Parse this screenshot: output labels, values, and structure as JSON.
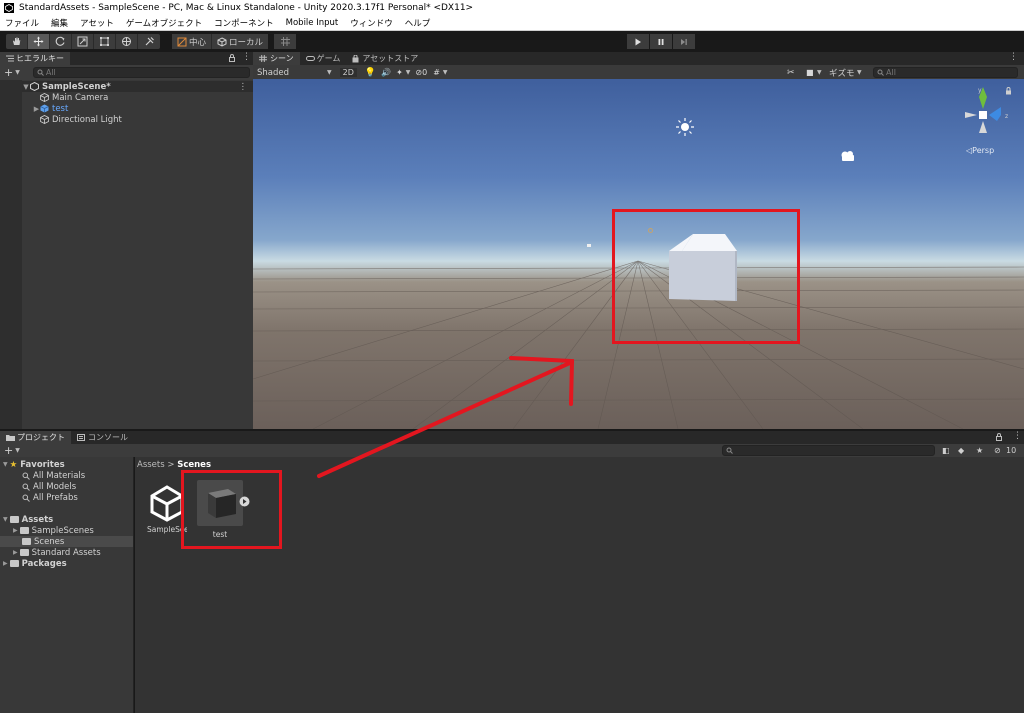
{
  "window": {
    "title": "StandardAssets - SampleScene - PC, Mac & Linux Standalone - Unity 2020.3.17f1 Personal* <DX11>"
  },
  "menu": [
    "ファイル",
    "編集",
    "アセット",
    "ゲームオブジェクト",
    "コンポーネント",
    "Mobile Input",
    "ウィンドウ",
    "ヘルプ"
  ],
  "toolbar": {
    "pivot_label": "中心",
    "space_label": "ローカル"
  },
  "hierarchy": {
    "tab_label": "ヒエラルキー",
    "search_placeholder": "All",
    "scene_name": "SampleScene*",
    "items": [
      "Main Camera",
      "test",
      "Directional Light"
    ]
  },
  "scene": {
    "tabs": [
      "シーン",
      "ゲーム",
      "アセットストア"
    ],
    "shading_mode": "Shaded",
    "mode_2d": "2D",
    "hidden_count": "0",
    "gizmos_label": "ギズモ",
    "search_placeholder": "All",
    "projection_label": "Persp"
  },
  "project": {
    "tabs": [
      "プロジェクト",
      "コンソール"
    ],
    "favorites_label": "Favorites",
    "favorites": [
      "All Materials",
      "All Models",
      "All Prefabs"
    ],
    "assets_label": "Assets",
    "asset_folders": [
      "SampleScenes",
      "Scenes",
      "Standard Assets"
    ],
    "packages_label": "Packages",
    "breadcrumb_root": "Assets",
    "breadcrumb_current": "Scenes",
    "visible_count": "10",
    "files": [
      "SampleScene",
      "test"
    ]
  },
  "colors": {
    "highlight": "#e3161f",
    "axis_y": "#6fbe3d",
    "axis_z": "#3d8be3",
    "selected_text": "#68a9ff"
  }
}
